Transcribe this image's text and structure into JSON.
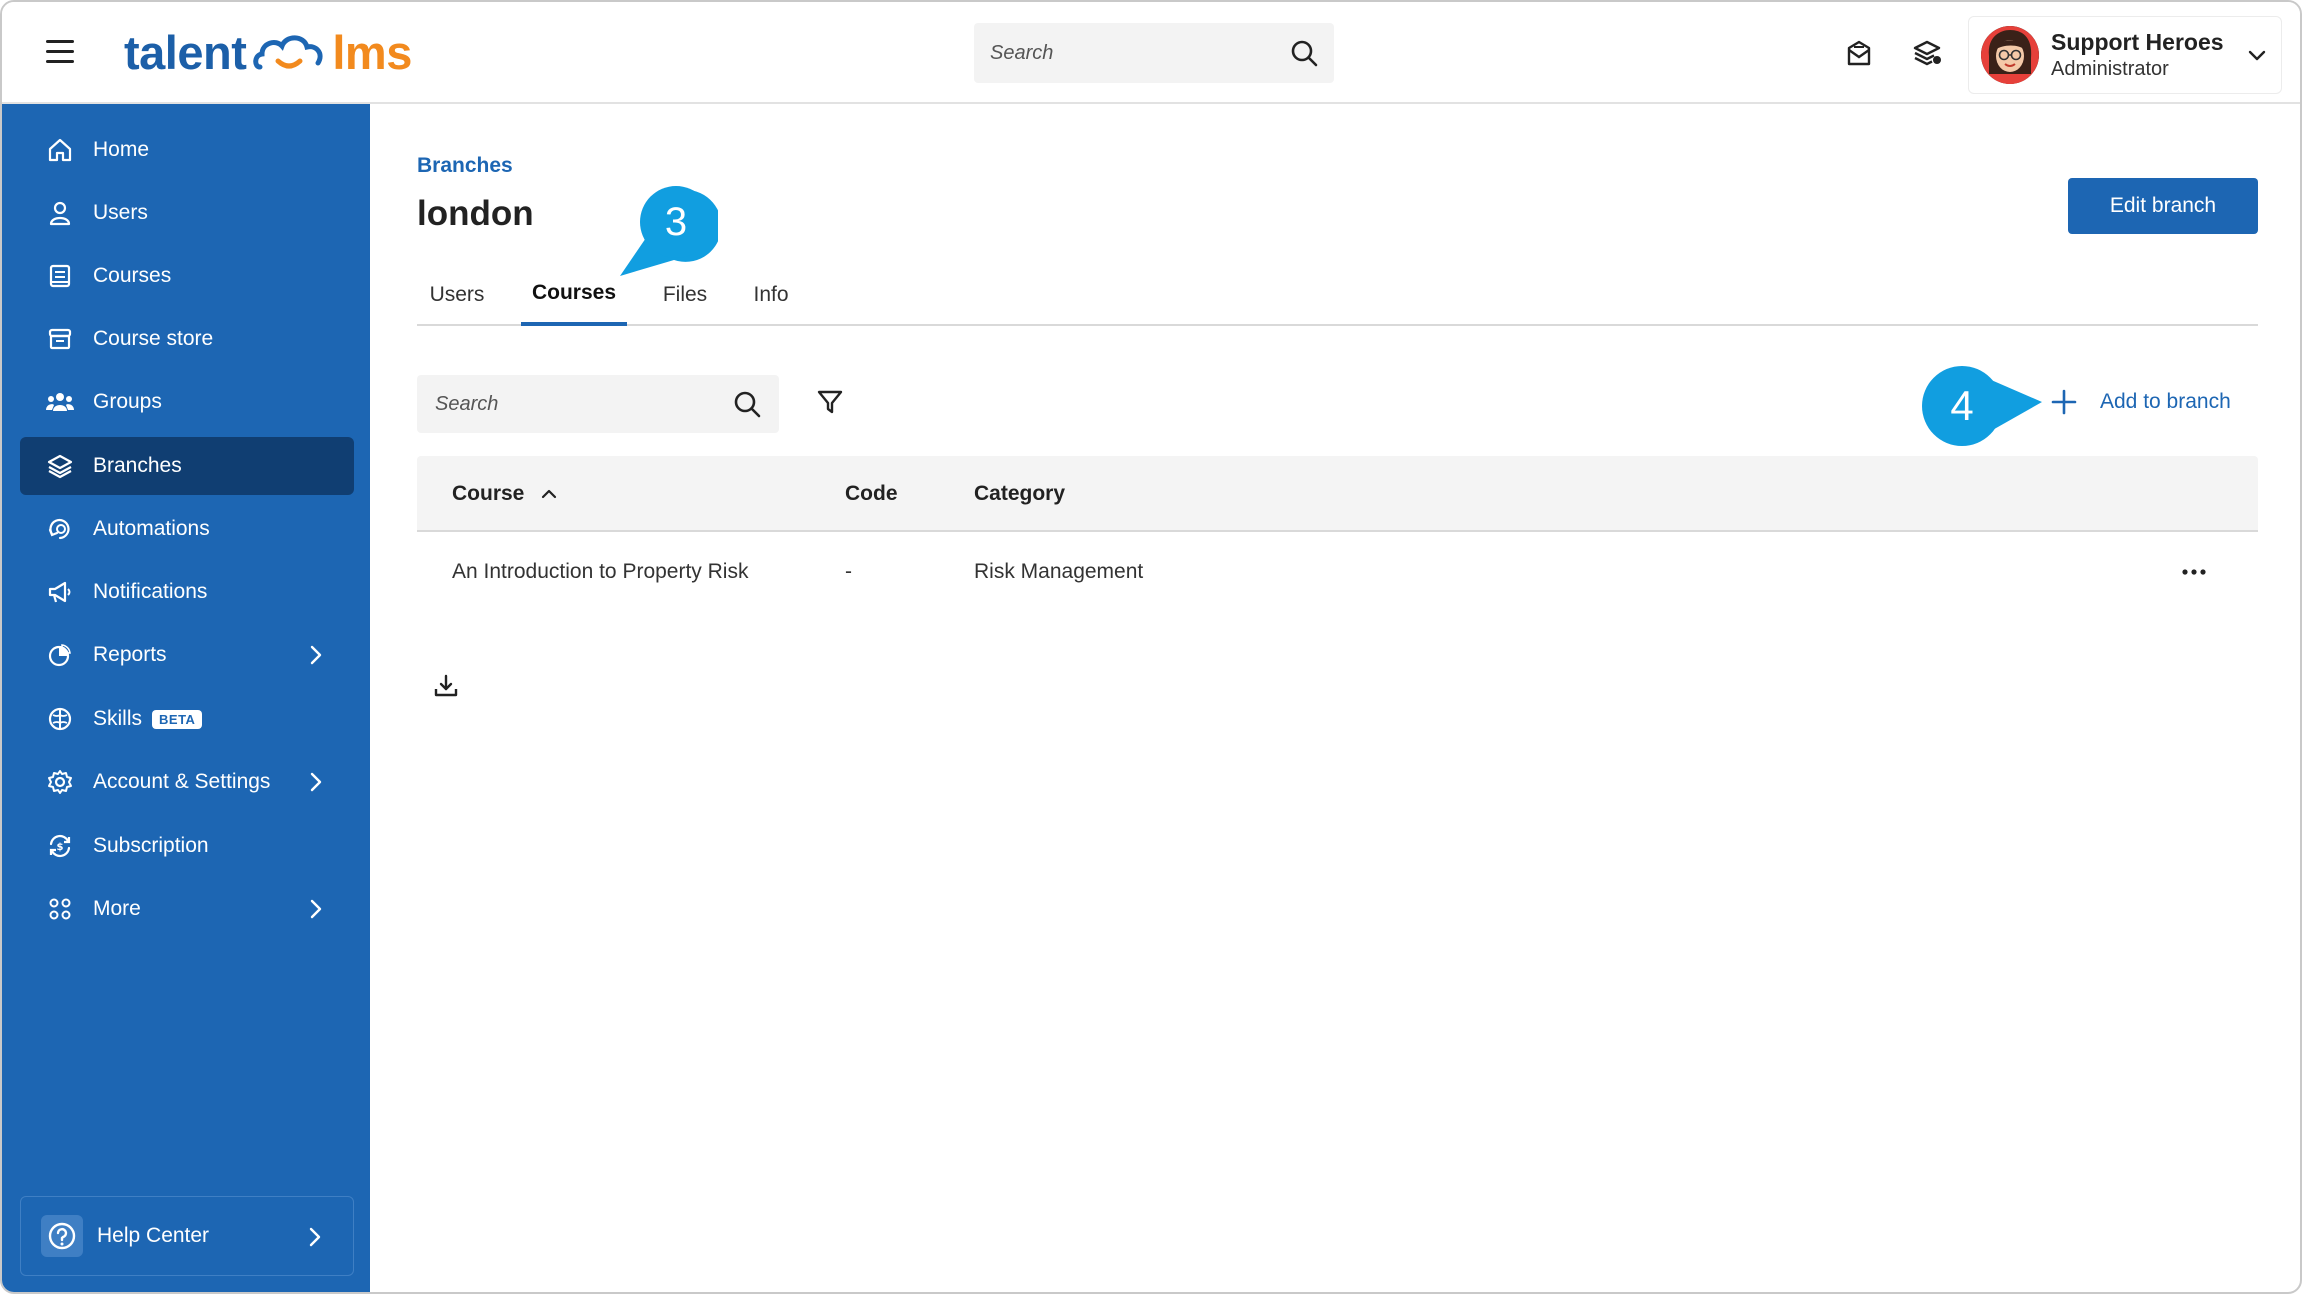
{
  "header": {
    "logo_left": "talent",
    "logo_right": "lms",
    "search_placeholder": "Search",
    "user_name": "Support Heroes",
    "user_role": "Administrator"
  },
  "sidebar": {
    "items": [
      {
        "label": "Home",
        "icon": "home-icon"
      },
      {
        "label": "Users",
        "icon": "user-icon"
      },
      {
        "label": "Courses",
        "icon": "book-icon"
      },
      {
        "label": "Course store",
        "icon": "store-icon"
      },
      {
        "label": "Groups",
        "icon": "group-icon"
      },
      {
        "label": "Branches",
        "icon": "layers-icon",
        "active": true
      },
      {
        "label": "Automations",
        "icon": "automation-icon"
      },
      {
        "label": "Notifications",
        "icon": "megaphone-icon"
      },
      {
        "label": "Reports",
        "icon": "pie-chart-icon",
        "has_submenu": true
      },
      {
        "label": "Skills",
        "icon": "brain-icon",
        "badge": "BETA"
      },
      {
        "label": "Account & Settings",
        "icon": "gear-icon",
        "has_submenu": true
      },
      {
        "label": "Subscription",
        "icon": "subscription-icon"
      },
      {
        "label": "More",
        "icon": "grid-icon",
        "has_submenu": true
      }
    ],
    "help_label": "Help Center"
  },
  "page": {
    "breadcrumb": "Branches",
    "title": "london",
    "edit_button": "Edit branch",
    "tabs": [
      {
        "label": "Users"
      },
      {
        "label": "Courses",
        "active": true
      },
      {
        "label": "Files"
      },
      {
        "label": "Info"
      }
    ],
    "search_placeholder": "Search",
    "add_label": "Add to branch"
  },
  "table": {
    "columns": [
      "Course",
      "Code",
      "Category"
    ],
    "sorted_by": "Course",
    "rows": [
      {
        "course": "An Introduction to Property Risk",
        "code": "-",
        "category": "Risk Management"
      }
    ]
  },
  "callouts": {
    "step3": "3",
    "step4": "4",
    "color": "#119ee0"
  },
  "colors": {
    "brand_blue": "#1d66b3",
    "sidebar_active": "#103e72",
    "logo_orange": "#f28a1e"
  }
}
